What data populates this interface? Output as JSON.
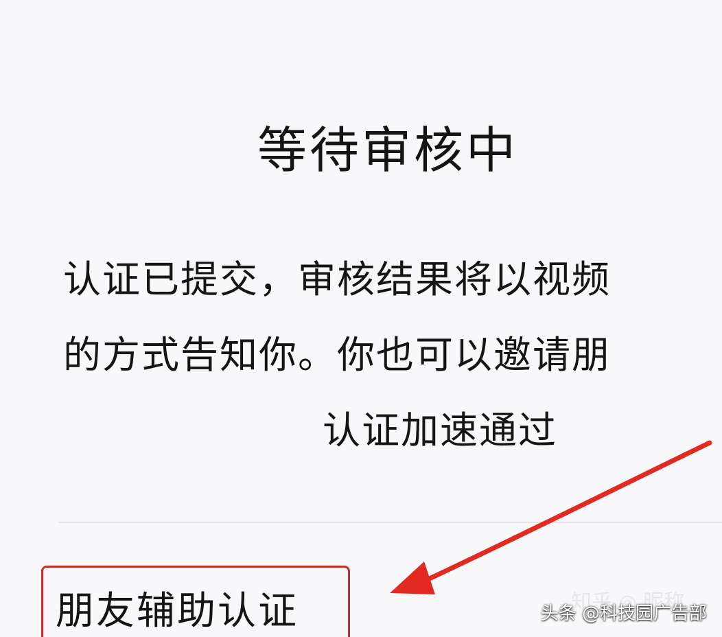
{
  "status": {
    "title": "等待审核中"
  },
  "description": {
    "line1": "认证已提交，审核结果将以视频",
    "line2": "的方式告知你。你也可以邀请朋",
    "line3": "认证加速通过"
  },
  "actions": {
    "friend_assist_label": "朋友辅助认证"
  },
  "watermark": {
    "text": "头条 @科技园广告部"
  },
  "colors": {
    "arrow": "#e02a22",
    "highlight_box": "#c9302c",
    "background": "#f8f8fa"
  },
  "icons": {
    "annotation": "red-arrow-icon"
  }
}
